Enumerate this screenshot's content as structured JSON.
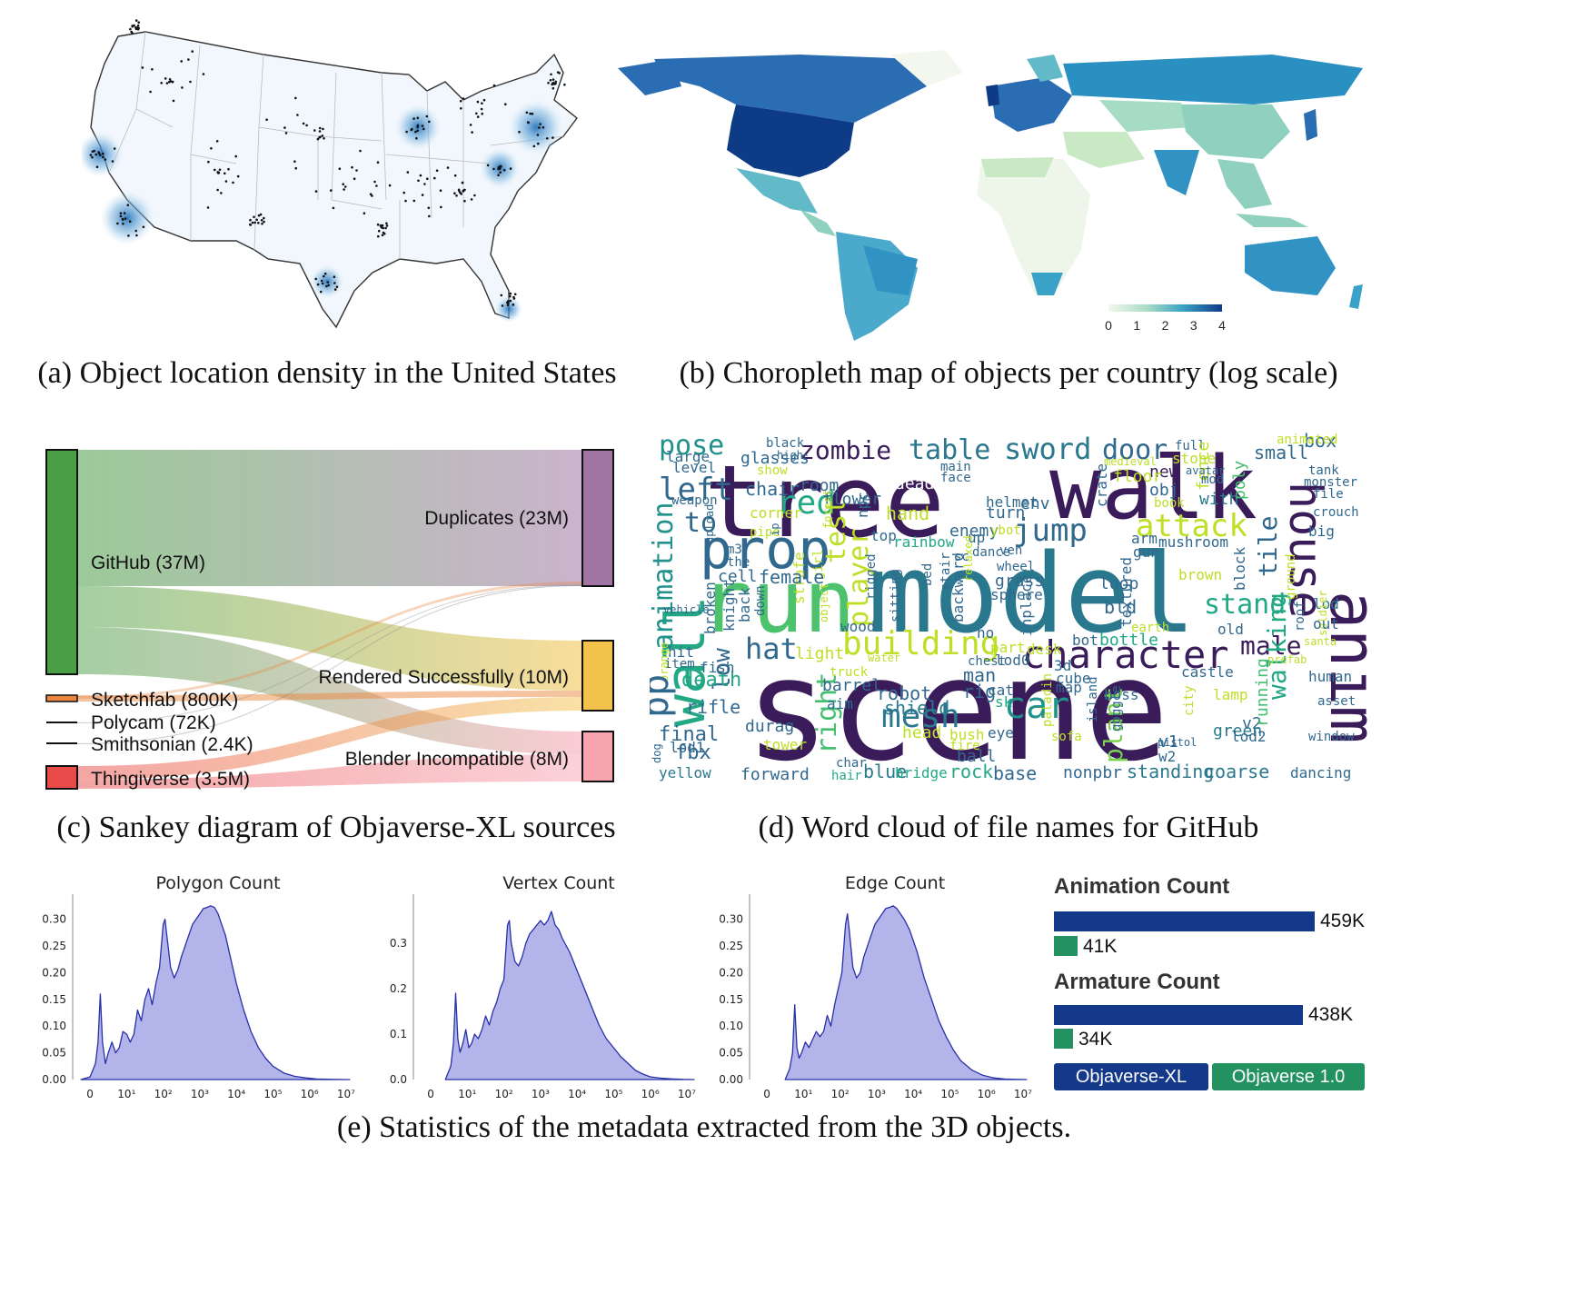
{
  "captions": {
    "a": "(a) Object location density in the United States",
    "b": "(b) Choropleth map of objects per country (log scale)",
    "c": "(c) Sankey diagram of Objaverse-XL sources",
    "d": "(d) Word cloud of file names for GitHub",
    "e": "(e) Statistics of the metadata extracted from the 3D objects."
  },
  "colors": {
    "github": "#4a9e45",
    "sketchfab": "#e9873f",
    "thingiverse": "#e94b4b",
    "duplicates": "#a075a3",
    "rendered": "#f3c24b",
    "incompatible": "#f7a3b0",
    "xl": "#14388a",
    "v1": "#239160",
    "density_fill": "#b3b5ea",
    "density_line": "#2730a8"
  },
  "chart_data": [
    {
      "type": "map",
      "id": "us-density",
      "description_visible": "density of object locations across US states, hotspots at SF Bay, LA, Chicago, NYC, Atlanta"
    },
    {
      "type": "choropleth",
      "id": "world",
      "colorbar": {
        "ticks": [
          "0",
          "1",
          "2",
          "3",
          "4"
        ],
        "range": [
          0,
          4
        ],
        "scale": "log"
      }
    },
    {
      "type": "sankey",
      "id": "sankey",
      "sources": [
        {
          "label": "GitHub (37M)",
          "value": 37
        },
        {
          "label": "Sketchfab (800K)",
          "value": 0.8
        },
        {
          "label": "Polycam (72K)",
          "value": 0.072
        },
        {
          "label": "Smithsonian (2.4K)",
          "value": 0.0024
        },
        {
          "label": "Thingiverse (3.5M)",
          "value": 3.5
        }
      ],
      "targets": [
        {
          "label": "Duplicates (23M)",
          "value": 23
        },
        {
          "label": "Rendered Successfully (10M)",
          "value": 10
        },
        {
          "label": "Blender Incompatible (8M)",
          "value": 8
        }
      ]
    },
    {
      "type": "wordcloud",
      "id": "words",
      "words": [
        "tree",
        "walk",
        "model",
        "scene",
        "run",
        "prop",
        "anim",
        "house",
        "character",
        "wall",
        "pose",
        "zombie",
        "table",
        "sword",
        "door",
        "left",
        "red",
        "animation",
        "to",
        "test",
        "player",
        "building",
        "attack",
        "jump",
        "stand",
        "tile",
        "mesh",
        "car",
        "hat",
        "male",
        "walking",
        "plant",
        "right",
        "low",
        "death",
        "final",
        "fbx",
        "yellow",
        "forward",
        "blue",
        "bridge",
        "rock",
        "base",
        "nonpbr",
        "standing",
        "coarse",
        "dancing",
        "box",
        "small",
        "full",
        "stone",
        "new",
        "obj",
        "with",
        "fence",
        "poly",
        "black",
        "glasses",
        "high",
        "large",
        "level",
        "show",
        "weapon",
        "chair",
        "corner",
        "pipe",
        "room",
        "flower",
        "npc",
        "dead",
        "combo",
        "helmet",
        "turn",
        "env",
        "hand",
        "floor",
        "crate",
        "book",
        "monster",
        "file",
        "tank",
        "crouch",
        "big",
        "mushroom",
        "arm",
        "gun",
        "brown",
        "block",
        "roof",
        "ground",
        "lod",
        "santa",
        "soldier",
        "out",
        "old",
        "bld",
        "loop",
        "pistol",
        "textured",
        "sphere",
        "grass",
        "inplace",
        "desk",
        "bot",
        "bottle",
        "earth",
        "prefab",
        "castle",
        "3d",
        "boss",
        "map",
        "cube",
        "part",
        "lod0",
        "robot",
        "shield",
        "water",
        "barrel",
        "truck",
        "light",
        "wood",
        "object",
        "strafe",
        "girl",
        "rigged",
        "sitting",
        "bed",
        "stair",
        "backward",
        "no",
        "enemy",
        "up",
        "dance",
        "wheel",
        "top",
        "rainbow",
        "forest",
        "relaxed",
        "sc",
        "the",
        "m3",
        "upload",
        "female",
        "cell",
        "back",
        "down",
        "knight",
        "broken",
        "hit",
        "item",
        "fish",
        "rifle",
        "orange",
        "durag",
        "tower",
        "char",
        "hair",
        "head",
        "bush",
        "ball",
        "eye",
        "fire",
        "cat",
        "sk",
        "man",
        "rig",
        "chest",
        "aim",
        "island",
        "goggle",
        "paladin",
        "sofa",
        "v1",
        "w2",
        "v2",
        "green",
        "lod2",
        "lamp",
        "city",
        "running",
        "window",
        "asset",
        "human",
        "ybot",
        "veh",
        "vehicle",
        "avatar",
        "animated",
        "main",
        "face",
        "lod1",
        "dog",
        "pp",
        "ip",
        "mod",
        "medieval"
      ]
    },
    {
      "type": "area",
      "id": "polygon",
      "title": "Polygon Count",
      "xlim": [
        -0.35,
        7.35
      ],
      "ylim": [
        0,
        0.34
      ],
      "yticks": [
        "0.00",
        "0.05",
        "0.10",
        "0.15",
        "0.20",
        "0.25",
        "0.30"
      ],
      "xticks": [
        "0",
        "10¹",
        "10²",
        "10³",
        "10⁴",
        "10⁵",
        "10⁶",
        "10⁷"
      ],
      "x": [
        -0.25,
        0.0,
        0.15,
        0.22,
        0.28,
        0.34,
        0.42,
        0.5,
        0.6,
        0.7,
        0.8,
        0.9,
        1.0,
        1.1,
        1.2,
        1.3,
        1.4,
        1.5,
        1.6,
        1.7,
        1.8,
        1.9,
        2.0,
        2.05,
        2.1,
        2.2,
        2.3,
        2.4,
        2.5,
        2.6,
        2.7,
        2.8,
        2.9,
        3.0,
        3.1,
        3.2,
        3.3,
        3.4,
        3.5,
        3.6,
        3.7,
        3.8,
        3.9,
        4.0,
        4.2,
        4.4,
        4.6,
        4.8,
        5.0,
        5.3,
        5.6,
        5.9,
        6.2,
        6.5,
        6.8,
        7.1
      ],
      "y": [
        0,
        0.005,
        0.03,
        0.07,
        0.16,
        0.07,
        0.03,
        0.05,
        0.07,
        0.05,
        0.06,
        0.09,
        0.085,
        0.07,
        0.085,
        0.13,
        0.11,
        0.15,
        0.17,
        0.14,
        0.18,
        0.21,
        0.29,
        0.3,
        0.27,
        0.21,
        0.19,
        0.205,
        0.23,
        0.25,
        0.27,
        0.29,
        0.3,
        0.31,
        0.32,
        0.322,
        0.325,
        0.322,
        0.31,
        0.29,
        0.27,
        0.24,
        0.21,
        0.18,
        0.13,
        0.09,
        0.06,
        0.04,
        0.025,
        0.012,
        0.006,
        0.003,
        0.001,
        0.0005,
        0.0002,
        0
      ]
    },
    {
      "type": "area",
      "id": "vertex",
      "title": "Vertex Count",
      "xlim": [
        -0.35,
        7.35
      ],
      "ylim": [
        0,
        0.4
      ],
      "yticks": [
        "0.0",
        "0.1",
        "0.2",
        "0.3"
      ],
      "xticks": [
        "0",
        "10¹",
        "10²",
        "10³",
        "10⁴",
        "10⁵",
        "10⁶",
        "10⁷"
      ],
      "x": [
        0.4,
        0.55,
        0.62,
        0.68,
        0.74,
        0.8,
        0.88,
        0.96,
        1.04,
        1.12,
        1.2,
        1.3,
        1.4,
        1.5,
        1.6,
        1.7,
        1.8,
        1.9,
        2.0,
        2.1,
        2.15,
        2.2,
        2.3,
        2.4,
        2.5,
        2.6,
        2.7,
        2.8,
        2.9,
        3.0,
        3.1,
        3.2,
        3.3,
        3.4,
        3.5,
        3.6,
        3.8,
        4.0,
        4.2,
        4.4,
        4.6,
        4.8,
        5.0,
        5.2,
        5.4,
        5.6,
        5.8,
        6.0,
        6.3,
        6.6,
        6.9,
        7.2
      ],
      "y": [
        0,
        0.03,
        0.08,
        0.19,
        0.09,
        0.06,
        0.08,
        0.11,
        0.07,
        0.08,
        0.1,
        0.09,
        0.11,
        0.14,
        0.12,
        0.15,
        0.17,
        0.2,
        0.22,
        0.34,
        0.35,
        0.3,
        0.26,
        0.25,
        0.27,
        0.3,
        0.32,
        0.33,
        0.34,
        0.35,
        0.34,
        0.35,
        0.37,
        0.34,
        0.33,
        0.31,
        0.28,
        0.24,
        0.2,
        0.16,
        0.12,
        0.09,
        0.07,
        0.05,
        0.035,
        0.02,
        0.012,
        0.006,
        0.003,
        0.0015,
        0.0005,
        0
      ]
    },
    {
      "type": "area",
      "id": "edge",
      "title": "Edge Count",
      "xlim": [
        -0.35,
        7.35
      ],
      "ylim": [
        0,
        0.34
      ],
      "yticks": [
        "0.00",
        "0.05",
        "0.10",
        "0.15",
        "0.20",
        "0.25",
        "0.30"
      ],
      "xticks": [
        "0",
        "10¹",
        "10²",
        "10³",
        "10⁴",
        "10⁵",
        "10⁶",
        "10⁷"
      ],
      "x": [
        0.5,
        0.62,
        0.7,
        0.76,
        0.82,
        0.88,
        0.95,
        1.05,
        1.15,
        1.25,
        1.35,
        1.45,
        1.55,
        1.65,
        1.75,
        1.85,
        1.95,
        2.05,
        2.15,
        2.2,
        2.25,
        2.35,
        2.45,
        2.55,
        2.65,
        2.75,
        2.85,
        2.95,
        3.05,
        3.15,
        3.25,
        3.35,
        3.45,
        3.55,
        3.65,
        3.75,
        3.9,
        4.1,
        4.3,
        4.5,
        4.7,
        4.9,
        5.1,
        5.3,
        5.6,
        5.9,
        6.2,
        6.5,
        6.8,
        7.1
      ],
      "y": [
        0,
        0.02,
        0.05,
        0.14,
        0.06,
        0.04,
        0.05,
        0.07,
        0.06,
        0.075,
        0.09,
        0.08,
        0.09,
        0.12,
        0.1,
        0.14,
        0.17,
        0.2,
        0.29,
        0.31,
        0.28,
        0.21,
        0.19,
        0.2,
        0.23,
        0.25,
        0.27,
        0.29,
        0.3,
        0.31,
        0.32,
        0.322,
        0.325,
        0.32,
        0.31,
        0.3,
        0.28,
        0.24,
        0.19,
        0.15,
        0.11,
        0.08,
        0.055,
        0.035,
        0.018,
        0.008,
        0.003,
        0.001,
        0.0003,
        0
      ]
    },
    {
      "type": "bar",
      "id": "animation",
      "title": "Animation Count",
      "orientation": "horizontal",
      "series": [
        {
          "name": "Objaverse-XL",
          "value": 459,
          "label": "459K"
        },
        {
          "name": "Objaverse 1.0",
          "value": 41,
          "label": "41K"
        }
      ]
    },
    {
      "type": "bar",
      "id": "armature",
      "title": "Armature Count",
      "orientation": "horizontal",
      "series": [
        {
          "name": "Objaverse-XL",
          "value": 438,
          "label": "438K"
        },
        {
          "name": "Objaverse 1.0",
          "value": 34,
          "label": "34K"
        }
      ]
    }
  ],
  "legend": {
    "xl": "Objaverse-XL",
    "v1": "Objaverse 1.0"
  }
}
